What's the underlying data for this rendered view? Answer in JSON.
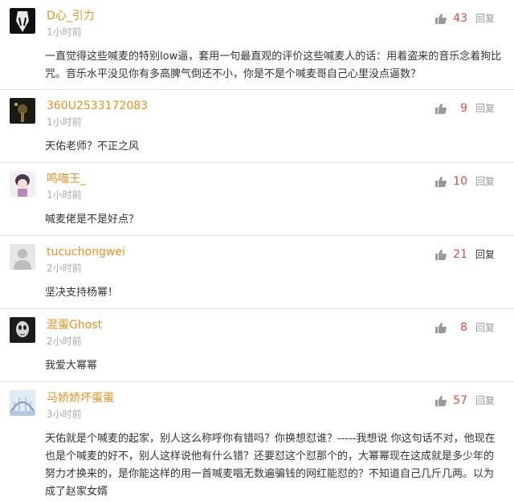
{
  "comments": [
    {
      "user": "D心_引力",
      "time": "1小时前",
      "likes": "43",
      "reply": "回复",
      "text": "一直觉得这些喊麦的特别low逼，套用一句最直观的评价这些喊麦人的话：用着盗来的音乐念着狗比咒。音乐水平没见你有多高脾气倒还不小，你是不是个喊麦哥自己心里没点逼数？"
    },
    {
      "user": "360U2533172083",
      "time": "1小时前",
      "likes": "9",
      "reply": "回复",
      "text": "天佑老师？不正之风"
    },
    {
      "user": "鸣喵王_",
      "time": "1小时前",
      "likes": "10",
      "reply": "回复",
      "text": "喊麦佬是不是好点？"
    },
    {
      "user": "tucuchongwei",
      "time": "2小时前",
      "likes": "21",
      "reply": "回复",
      "text": "坚决支持杨幂！"
    },
    {
      "user": "混蛋Ghost",
      "time": "2小时前",
      "likes": "8",
      "reply": "回复",
      "text": "我爱大幂幂"
    },
    {
      "user": "马娇娇坏蛋蛋",
      "time": "3小时前",
      "likes": "57",
      "reply": "回复",
      "text": "天佑就是个喊麦的起家，别人这么称呼你有错吗？你换想怼谁？-----我想说 你这句话不对，他现在也是个喊麦的好不，别人这样说他有什么错？还要怼这个怼那个的，大幂幂现在这成就是多少年的努力才换来的，是你能这样的用一首喊麦唱无数遍骗钱的网红能怼的？不知道自己几斤几两。以为成了赵家女婿"
    }
  ],
  "colors": {
    "username": "#e8901f",
    "likes": "#e14b3b",
    "time": "#aaaaaa",
    "divider": "#e4e4e4"
  },
  "icons": {
    "like": "thumbs-up-icon"
  }
}
